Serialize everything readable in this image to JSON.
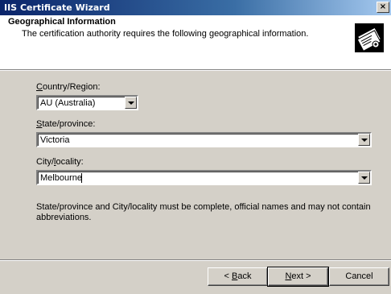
{
  "window": {
    "title": "IIS Certificate Wizard",
    "close_glyph": "×"
  },
  "header": {
    "title": "Geographical Information",
    "subtitle": "The certification authority requires the following geographical information.",
    "icon": "certificate-icon"
  },
  "form": {
    "country": {
      "label_accel": "C",
      "label_rest": "ountry/Region:",
      "value": "AU (Australia)"
    },
    "state": {
      "label_accel": "S",
      "label_rest": "tate/province:",
      "value": "Victoria"
    },
    "city": {
      "label_before": "City/",
      "label_accel": "l",
      "label_after": "ocality:",
      "value": "Melbourne"
    },
    "note": "State/province and City/locality must be complete, official names and may not contain abbreviations."
  },
  "buttons": {
    "back": {
      "prefix": "< ",
      "accel": "B",
      "rest": "ack"
    },
    "next": {
      "accel": "N",
      "rest": "ext >"
    },
    "cancel": "Cancel"
  }
}
